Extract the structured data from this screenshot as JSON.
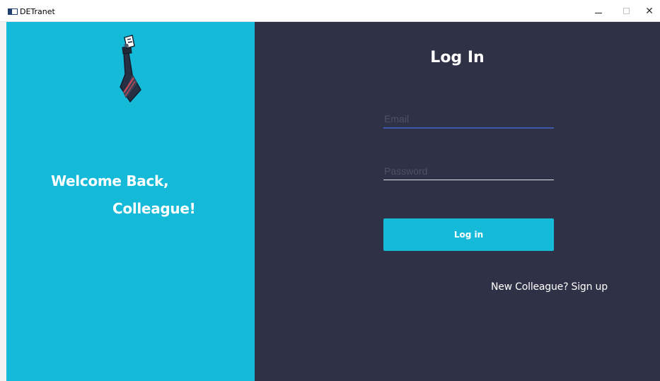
{
  "window": {
    "title": "DETranet",
    "controls": {
      "minimize": "–",
      "maximize": "□",
      "close": "✕"
    }
  },
  "welcome": {
    "line1": "Welcome Back,",
    "line2": "Colleague!"
  },
  "login": {
    "title": "Log In",
    "email_placeholder": "Email",
    "password_placeholder": "Password",
    "button_label": "Log in",
    "signup_link": "New Colleague? Sign up"
  },
  "colors": {
    "accent": "#15bad8",
    "panel_dark": "#2f3246",
    "email_underline": "#3e5aa8"
  }
}
